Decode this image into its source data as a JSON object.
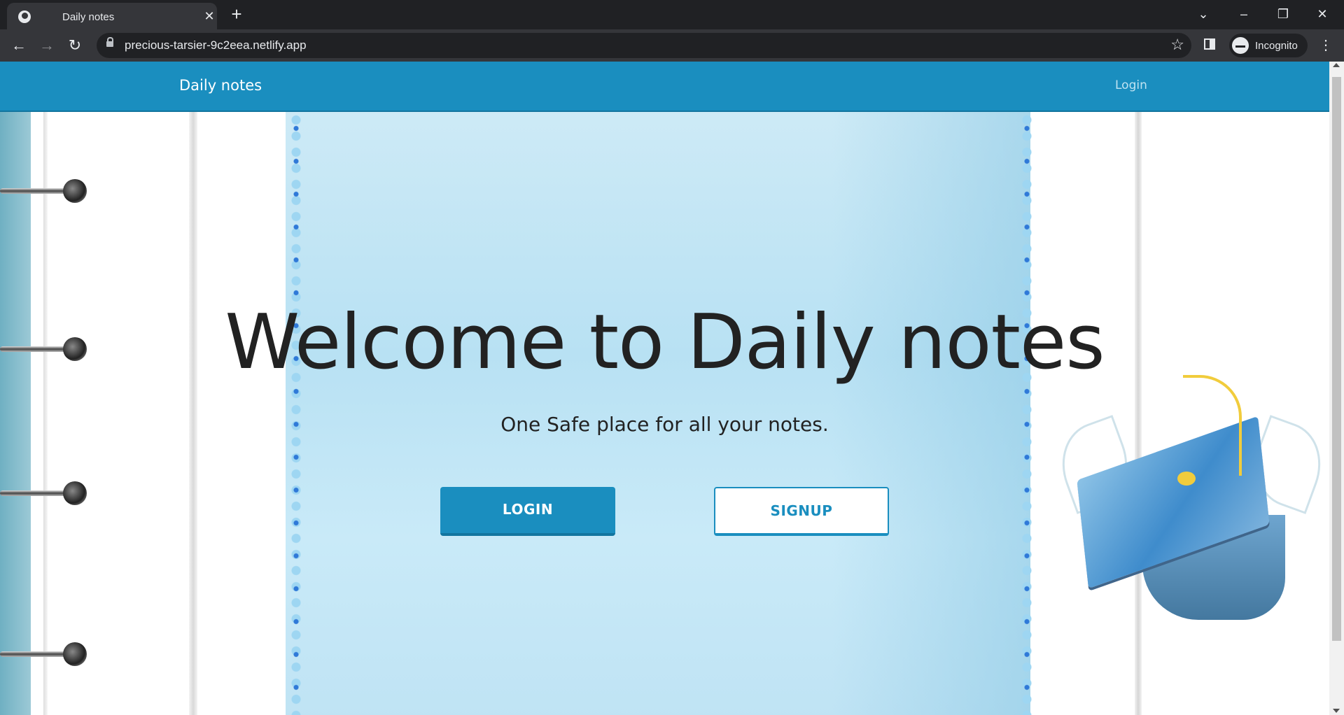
{
  "browser": {
    "tab_title": "Daily notes",
    "tab_close": "✕",
    "new_tab": "+",
    "url": "precious-tarsier-9c2eea.netlify.app",
    "profile_label": "Incognito",
    "back": "←",
    "forward": "→",
    "reload": "↻",
    "bookmark": "☆",
    "menu": "⋮",
    "tab_search": "⌄",
    "minimize": "–",
    "restore": "❐",
    "close": "✕"
  },
  "navbar": {
    "brand": "Daily notes",
    "login": "Login",
    "color": "#1a8ebf"
  },
  "hero": {
    "title": "Welcome to Daily notes",
    "subtitle": "One Safe place for all your notes.",
    "login_button": "LOGIN",
    "signup_button": "SIGNUP"
  },
  "icons": {
    "favicon": "globe-icon",
    "lock": "lock-icon",
    "incognito": "incognito-icon",
    "side_panel": "side-panel-icon"
  }
}
